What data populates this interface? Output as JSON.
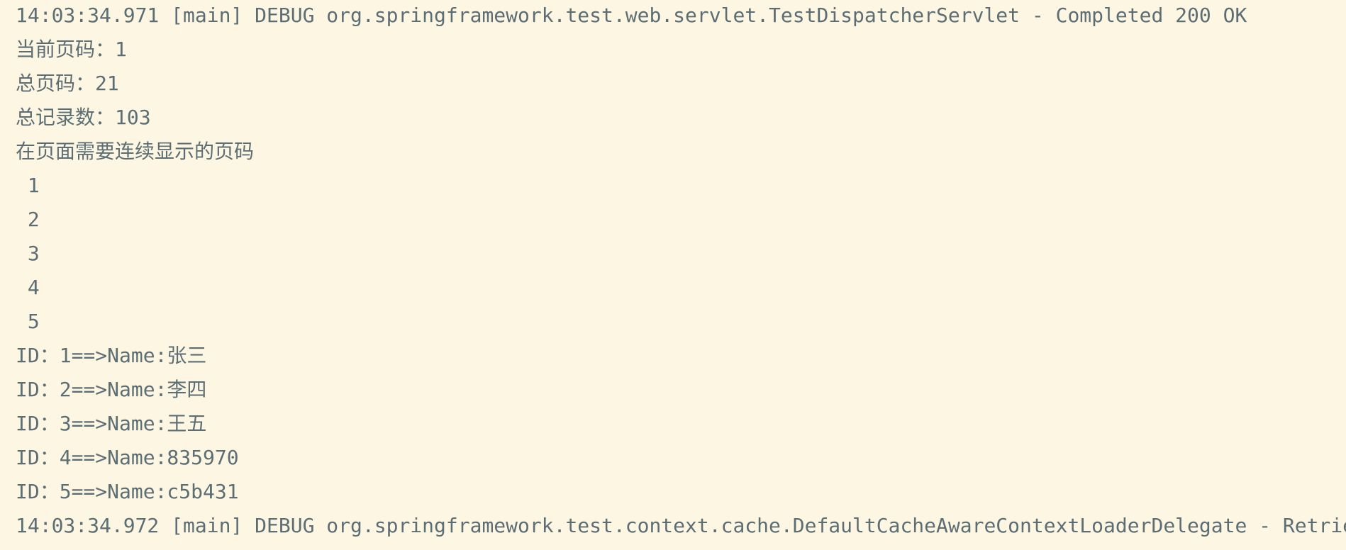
{
  "console": {
    "background_color": "#fdf6e3",
    "text_color": "#5c6e74",
    "lines": [
      "14:03:34.971 [main] DEBUG org.springframework.test.web.servlet.TestDispatcherServlet - Completed 200 OK",
      "当前页码：1",
      "总页码：21",
      "总记录数：103",
      "在页面需要连续显示的页码",
      " 1",
      " 2",
      " 3",
      " 4",
      " 5",
      "ID：1==>Name:张三",
      "ID：2==>Name:李四",
      "ID：3==>Name:王五",
      "ID：4==>Name:835970",
      "ID：5==>Name:c5b431",
      "14:03:34.972 [main] DEBUG org.springframework.test.context.cache.DefaultCacheAwareContextLoaderDelegate - Retrie"
    ]
  }
}
